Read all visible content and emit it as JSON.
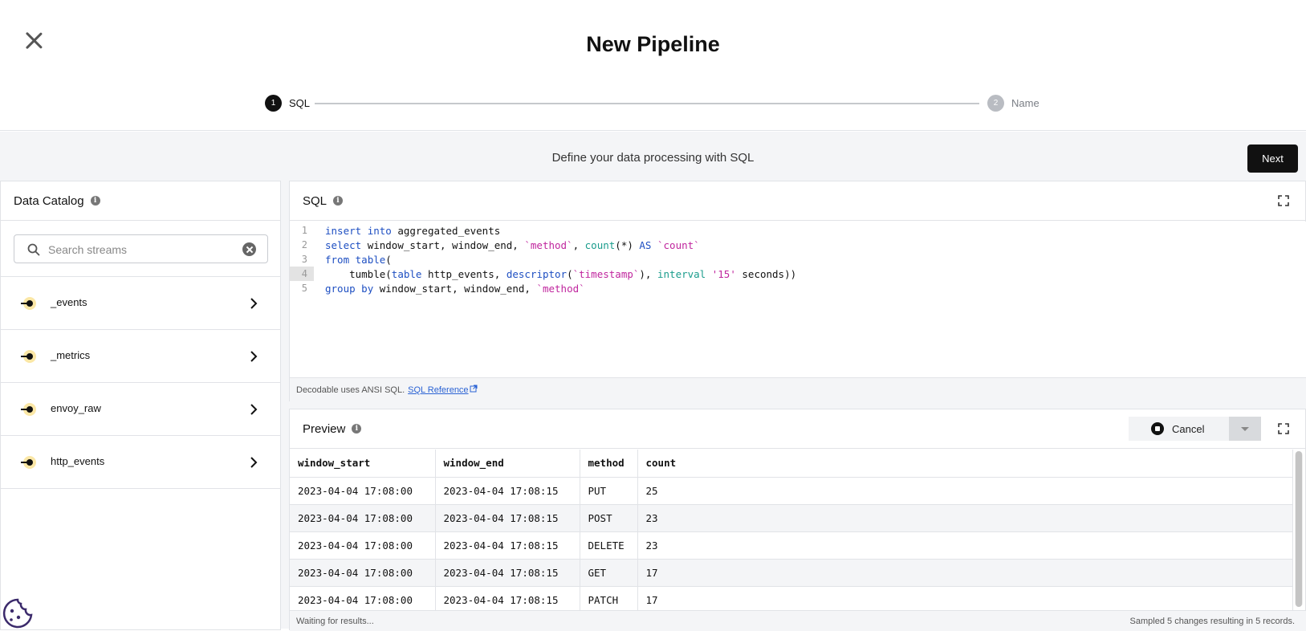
{
  "header": {
    "title": "New Pipeline",
    "steps": [
      {
        "num": "1",
        "label": "SQL"
      },
      {
        "num": "2",
        "label": "Name"
      }
    ]
  },
  "toolbar": {
    "subtitle": "Define your data processing with SQL",
    "next_label": "Next"
  },
  "catalog": {
    "title": "Data Catalog",
    "search_placeholder": "Search streams",
    "streams": [
      {
        "label": "_events"
      },
      {
        "label": "_metrics"
      },
      {
        "label": "envoy_raw"
      },
      {
        "label": "http_events"
      }
    ]
  },
  "sql": {
    "title": "SQL",
    "lines": [
      {
        "num": "1"
      },
      {
        "num": "2"
      },
      {
        "num": "3"
      },
      {
        "num": "4"
      },
      {
        "num": "5"
      }
    ],
    "footer_text": "Decodable uses ANSI SQL.",
    "footer_link": "SQL Reference",
    "code": {
      "l1": {
        "k1": "insert",
        "k2": "into",
        "t": "aggregated_events"
      },
      "l2": {
        "k1": "select",
        "t1": "window_start, window_end,",
        "s1": "`method`",
        "t2": ",",
        "f1": "count",
        "t3": "(*)",
        "k2": "AS",
        "s2": "`count`"
      },
      "l3": {
        "k1": "from",
        "k2": "table",
        "t": "("
      },
      "l4": {
        "t1": "tumble(",
        "k1": "table",
        "t2": "http_events,",
        "f1": "descriptor",
        "t3": "(",
        "s1": "`timestamp`",
        "t4": "),",
        "f2": "interval",
        "s2": "'15'",
        "t5": "seconds))"
      },
      "l5": {
        "k1": "group",
        "k2": "by",
        "t1": "window_start, window_end,",
        "s1": "`method`"
      }
    }
  },
  "preview": {
    "title": "Preview",
    "cancel_label": "Cancel",
    "columns": [
      "window_start",
      "window_end",
      "method",
      "count"
    ],
    "rows": [
      [
        "2023-04-04 17:08:00",
        "2023-04-04 17:08:15",
        "PUT",
        "25"
      ],
      [
        "2023-04-04 17:08:00",
        "2023-04-04 17:08:15",
        "POST",
        "23"
      ],
      [
        "2023-04-04 17:08:00",
        "2023-04-04 17:08:15",
        "DELETE",
        "23"
      ],
      [
        "2023-04-04 17:08:00",
        "2023-04-04 17:08:15",
        "GET",
        "17"
      ],
      [
        "2023-04-04 17:08:00",
        "2023-04-04 17:08:15",
        "PATCH",
        "17"
      ]
    ],
    "status_left": "Waiting for results...",
    "status_right": "Sampled 5 changes resulting in 5 records."
  },
  "colors": {
    "accent": "#111111",
    "stream_icon": "#f5c518",
    "keyword": "#1e4fc2",
    "function": "#1a9c8c",
    "string": "#c0269e"
  },
  "icons": {
    "close": "close-icon",
    "info": "info-icon",
    "search": "search-icon",
    "clear": "clear-icon",
    "stream": "stream-icon",
    "chevron": "chevron-right-icon",
    "expand": "expand-icon",
    "stop": "stop-icon",
    "cookie": "cookie-icon"
  }
}
